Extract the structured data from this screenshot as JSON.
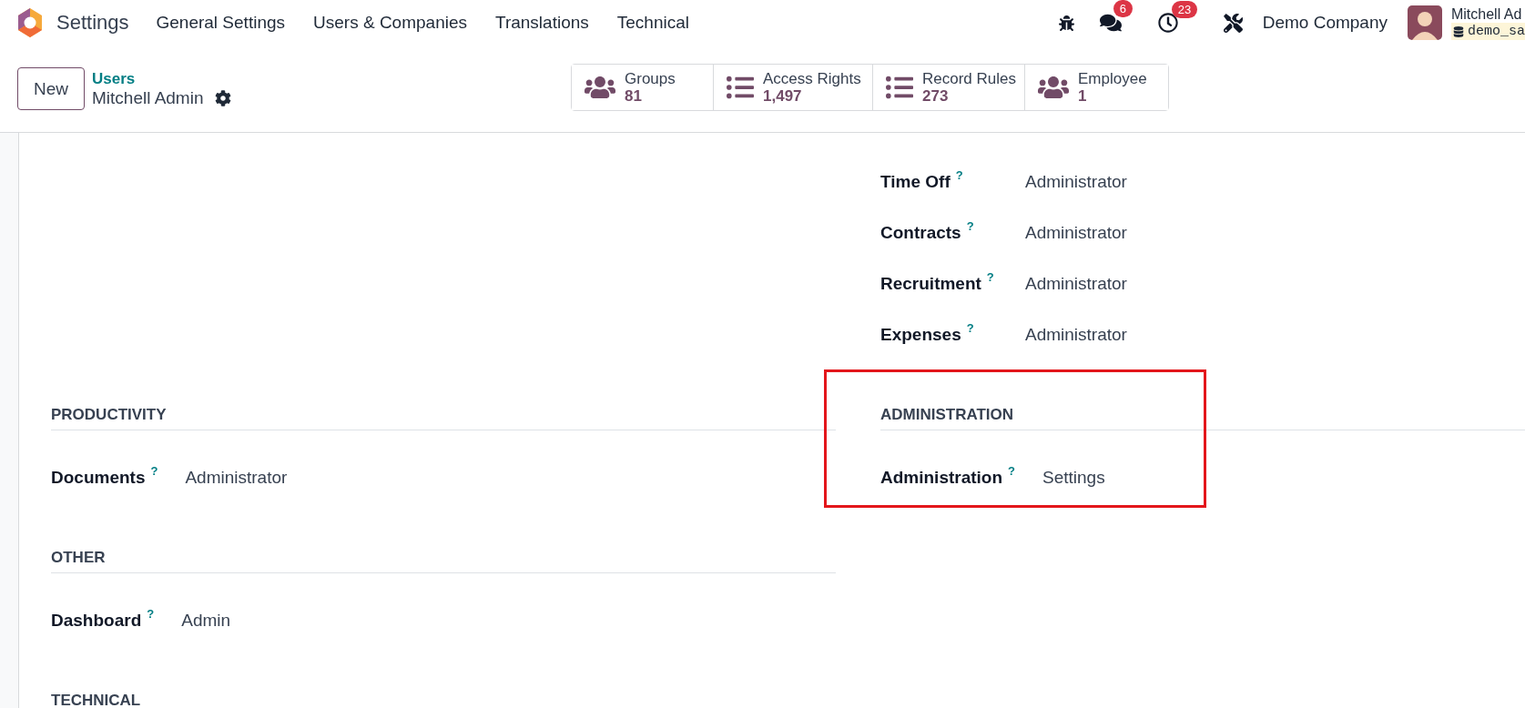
{
  "app": {
    "name": "Settings"
  },
  "menu": [
    "General Settings",
    "Users & Companies",
    "Translations",
    "Technical"
  ],
  "systray": {
    "messages_count": "6",
    "activities_count": "23",
    "company": "Demo Company",
    "user_name": "Mitchell Ad",
    "database": "demo_sa"
  },
  "control_panel": {
    "new_button": "New",
    "breadcrumb": "Users",
    "record": "Mitchell Admin"
  },
  "stat_buttons": [
    {
      "kind": "people",
      "label": "Groups",
      "value": "81"
    },
    {
      "kind": "list",
      "label": "Access Rights",
      "value": "1,497"
    },
    {
      "kind": "list",
      "label": "Record Rules",
      "value": "273"
    },
    {
      "kind": "people",
      "label": "Employee",
      "value": "1"
    }
  ],
  "groups": [
    {
      "right": {
        "rows": [
          {
            "label": "Time Off",
            "help": "?",
            "value": "Administrator"
          },
          {
            "label": "Contracts",
            "help": "?",
            "value": "Administrator"
          },
          {
            "label": "Recruitment",
            "help": "?",
            "value": "Administrator"
          },
          {
            "label": "Expenses",
            "help": "?",
            "value": "Administrator"
          }
        ]
      }
    },
    {
      "left": {
        "title": "PRODUCTIVITY",
        "rows": [
          {
            "label": "Documents",
            "help": "?",
            "value": "Administrator"
          }
        ]
      },
      "right": {
        "title": "ADMINISTRATION",
        "highlighted": true,
        "rows": [
          {
            "label": "Administration",
            "help": "?",
            "value": "Settings"
          }
        ]
      }
    },
    {
      "left": {
        "title": "OTHER",
        "rows": [
          {
            "label": "Dashboard",
            "help": "?",
            "value": "Admin"
          }
        ]
      }
    },
    {
      "left": {
        "title": "TECHNICAL"
      }
    }
  ]
}
